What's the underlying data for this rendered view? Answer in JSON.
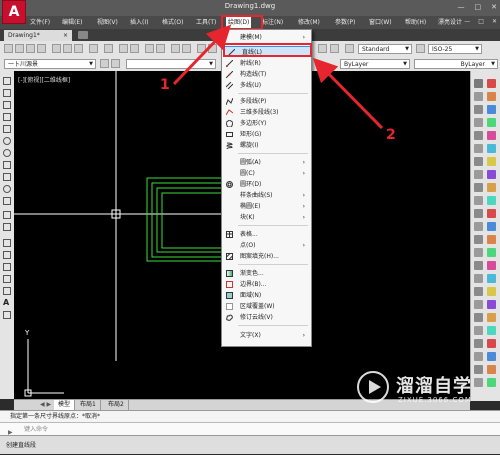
{
  "window": {
    "title": "Drawing1.dwg",
    "logo": "A",
    "controls": [
      "—",
      "□",
      "✕"
    ]
  },
  "menubar": {
    "items": [
      {
        "label": "文件(F)",
        "key": "file"
      },
      {
        "label": "编辑(E)",
        "key": "edit"
      },
      {
        "label": "视图(V)",
        "key": "view"
      },
      {
        "label": "插入(I)",
        "key": "insert"
      },
      {
        "label": "格式(O)",
        "key": "format"
      },
      {
        "label": "工具(T)",
        "key": "tools"
      },
      {
        "label": "绘图(D)",
        "key": "draw"
      },
      {
        "label": "标注(N)",
        "key": "dimension"
      },
      {
        "label": "修改(M)",
        "key": "modify"
      },
      {
        "label": "参数(P)",
        "key": "parametric"
      },
      {
        "label": "窗口(W)",
        "key": "window"
      },
      {
        "label": "帮助(H)",
        "key": "help"
      },
      {
        "label": "漂亮设计",
        "key": "extra"
      }
    ],
    "mdi_controls": [
      "—",
      "□",
      "✕"
    ]
  },
  "tabs": {
    "active": "Drawing1*",
    "close": "×"
  },
  "toolbar": {
    "text_style": "Standard",
    "dim_style": "ISO-25",
    "layer": "ByLayer",
    "linetype": "ByLayer",
    "workspace": "一卜川源景"
  },
  "canvas": {
    "view_label": "[-][俯视][二维线框]",
    "axis_y": "Y",
    "colors": {
      "background": "#000000",
      "shape": "#3ddc3d",
      "crosshair": "#ffffff"
    }
  },
  "draw_menu": {
    "items": [
      {
        "label": "建模(M)",
        "submenu": true,
        "icon": "none"
      },
      {
        "label": "直线(L)",
        "submenu": false,
        "icon": "line-icon",
        "selected": true
      },
      {
        "label": "射线(R)",
        "submenu": false,
        "icon": "ray-icon"
      },
      {
        "label": "构造线(T)",
        "submenu": false,
        "icon": "xline-icon"
      },
      {
        "label": "多线(U)",
        "submenu": false,
        "icon": "mline-icon"
      },
      {
        "label": "多段线(P)",
        "submenu": false,
        "icon": "polyline-icon"
      },
      {
        "label": "三维多段线(3)",
        "submenu": false,
        "icon": "3dpoly-icon"
      },
      {
        "label": "多边形(Y)",
        "submenu": false,
        "icon": "polygon-icon"
      },
      {
        "label": "矩形(G)",
        "submenu": false,
        "icon": "rectangle-icon"
      },
      {
        "label": "螺旋(I)",
        "submenu": false,
        "icon": "helix-icon"
      },
      {
        "label": "圆弧(A)",
        "submenu": true,
        "icon": "none"
      },
      {
        "label": "圆(C)",
        "submenu": true,
        "icon": "none"
      },
      {
        "label": "圆环(D)",
        "submenu": false,
        "icon": "donut-icon"
      },
      {
        "label": "样条曲线(S)",
        "submenu": true,
        "icon": "none"
      },
      {
        "label": "椭圆(E)",
        "submenu": true,
        "icon": "none"
      },
      {
        "label": "块(K)",
        "submenu": true,
        "icon": "none"
      },
      {
        "label": "表格...",
        "submenu": false,
        "icon": "table-icon"
      },
      {
        "label": "点(O)",
        "submenu": true,
        "icon": "none"
      },
      {
        "label": "图案填充(H)...",
        "submenu": false,
        "icon": "hatch-icon"
      },
      {
        "label": "渐变色...",
        "submenu": false,
        "icon": "gradient-icon"
      },
      {
        "label": "边界(B)...",
        "submenu": false,
        "icon": "boundary-icon"
      },
      {
        "label": "面域(N)",
        "submenu": false,
        "icon": "region-icon"
      },
      {
        "label": "区域覆盖(W)",
        "submenu": false,
        "icon": "wipeout-icon"
      },
      {
        "label": "修订云线(V)",
        "submenu": false,
        "icon": "revcloud-icon"
      },
      {
        "label": "文字(X)",
        "submenu": true,
        "icon": "none"
      }
    ],
    "submenu_arrow": "›"
  },
  "annotations": {
    "marker1": "1",
    "marker2": "2",
    "color": "#e6262e"
  },
  "layout_tabs": [
    "模型",
    "布局1",
    "布局2"
  ],
  "command": {
    "history": "指定第一条尺寸界线原点：*取消*",
    "placeholder": "键入命令",
    "status": "创建直线段"
  },
  "watermark": {
    "brand": "溜溜自学",
    "url": "ZIXUE.3066.COM"
  }
}
